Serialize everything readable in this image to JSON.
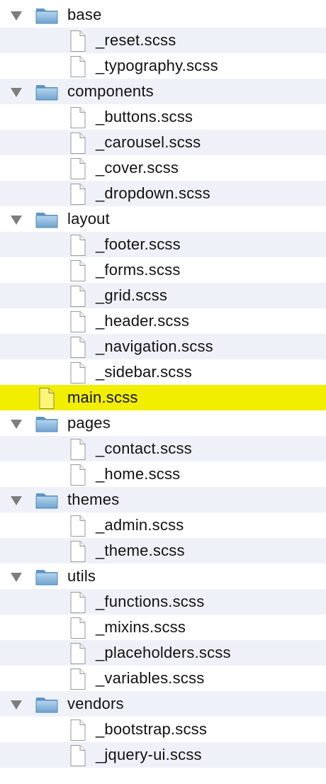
{
  "file_tree": [
    {
      "kind": "folder",
      "label": "base",
      "expanded": true,
      "icon": "folder-icon",
      "stripe": false
    },
    {
      "kind": "file",
      "label": "_reset.scss",
      "icon": "file-icon",
      "stripe": true
    },
    {
      "kind": "file",
      "label": "_typography.scss",
      "icon": "file-icon",
      "stripe": false
    },
    {
      "kind": "folder",
      "label": "components",
      "expanded": true,
      "icon": "folder-icon",
      "stripe": true
    },
    {
      "kind": "file",
      "label": "_buttons.scss",
      "icon": "file-icon",
      "stripe": false
    },
    {
      "kind": "file",
      "label": "_carousel.scss",
      "icon": "file-icon",
      "stripe": true
    },
    {
      "kind": "file",
      "label": "_cover.scss",
      "icon": "file-icon",
      "stripe": false
    },
    {
      "kind": "file",
      "label": "_dropdown.scss",
      "icon": "file-icon",
      "stripe": true
    },
    {
      "kind": "folder",
      "label": "layout",
      "expanded": true,
      "icon": "folder-icon",
      "stripe": false
    },
    {
      "kind": "file",
      "label": "_footer.scss",
      "icon": "file-icon",
      "stripe": true
    },
    {
      "kind": "file",
      "label": "_forms.scss",
      "icon": "file-icon",
      "stripe": false
    },
    {
      "kind": "file",
      "label": "_grid.scss",
      "icon": "file-icon",
      "stripe": true
    },
    {
      "kind": "file",
      "label": "_header.scss",
      "icon": "file-icon",
      "stripe": false
    },
    {
      "kind": "file",
      "label": "_navigation.scss",
      "icon": "file-icon",
      "stripe": true
    },
    {
      "kind": "file",
      "label": "_sidebar.scss",
      "icon": "file-icon",
      "stripe": false
    },
    {
      "kind": "root-file",
      "label": "main.scss",
      "icon": "file-icon",
      "highlighted": true,
      "stripe": false
    },
    {
      "kind": "folder",
      "label": "pages",
      "expanded": true,
      "icon": "folder-icon",
      "stripe": false
    },
    {
      "kind": "file",
      "label": "_contact.scss",
      "icon": "file-icon",
      "stripe": true
    },
    {
      "kind": "file",
      "label": "_home.scss",
      "icon": "file-icon",
      "stripe": false
    },
    {
      "kind": "folder",
      "label": "themes",
      "expanded": true,
      "icon": "folder-icon",
      "stripe": true
    },
    {
      "kind": "file",
      "label": "_admin.scss",
      "icon": "file-icon",
      "stripe": false
    },
    {
      "kind": "file",
      "label": "_theme.scss",
      "icon": "file-icon",
      "stripe": true
    },
    {
      "kind": "folder",
      "label": "utils",
      "expanded": true,
      "icon": "folder-icon",
      "stripe": false
    },
    {
      "kind": "file",
      "label": "_functions.scss",
      "icon": "file-icon",
      "stripe": true
    },
    {
      "kind": "file",
      "label": "_mixins.scss",
      "icon": "file-icon",
      "stripe": false
    },
    {
      "kind": "file",
      "label": "_placeholders.scss",
      "icon": "file-icon",
      "stripe": true
    },
    {
      "kind": "file",
      "label": "_variables.scss",
      "icon": "file-icon",
      "stripe": false
    },
    {
      "kind": "folder",
      "label": "vendors",
      "expanded": true,
      "icon": "folder-icon",
      "stripe": true
    },
    {
      "kind": "file",
      "label": "_bootstrap.scss",
      "icon": "file-icon",
      "stripe": false
    },
    {
      "kind": "file",
      "label": "_jquery-ui.scss",
      "icon": "file-icon",
      "stripe": true
    }
  ],
  "colors": {
    "stripe": "#eef2f8",
    "highlight": "#f2ee00",
    "folder": "#7fb1d9",
    "disclosure": "#7d7d7d",
    "text": "#111111"
  }
}
